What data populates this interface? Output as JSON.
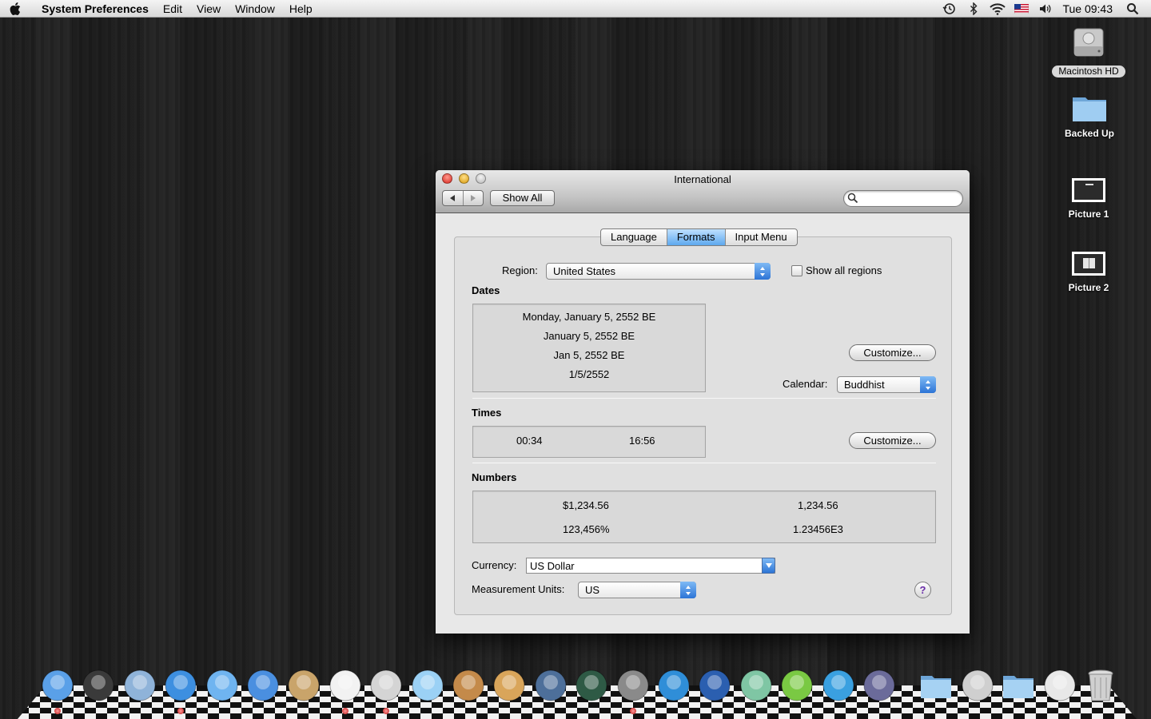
{
  "menubar": {
    "apple_label": "",
    "items": [
      "System Preferences",
      "Edit",
      "View",
      "Window",
      "Help"
    ],
    "clock": "Tue 09:43",
    "status_icons": [
      "time-machine-icon",
      "bluetooth-icon",
      "wifi-icon",
      "flag-icon",
      "volume-icon",
      "spotlight-icon"
    ]
  },
  "desktop": {
    "icons": [
      {
        "label": "Macintosh HD",
        "icon": "hard-drive-icon"
      },
      {
        "label": "Backed Up",
        "icon": "folder-icon"
      },
      {
        "label": "Picture 1",
        "icon": "image-file-icon"
      },
      {
        "label": "Picture 2",
        "icon": "image-file-icon"
      }
    ]
  },
  "window": {
    "title": "International",
    "show_all": "Show All",
    "search_placeholder": "",
    "tabs": [
      {
        "label": "Language",
        "active": false
      },
      {
        "label": "Formats",
        "active": true
      },
      {
        "label": "Input Menu",
        "active": false
      }
    ],
    "region": {
      "label": "Region:",
      "value": "United States"
    },
    "show_all_regions": {
      "label": "Show all regions",
      "checked": false
    },
    "dates": {
      "title": "Dates",
      "lines": [
        "Monday, January 5, 2552 BE",
        "January 5, 2552 BE",
        "Jan 5, 2552 BE",
        "1/5/2552"
      ],
      "customize": "Customize...",
      "calendar_label": "Calendar:",
      "calendar_value": "Buddhist"
    },
    "times": {
      "title": "Times",
      "values": [
        "00:34",
        "16:56"
      ],
      "customize": "Customize..."
    },
    "numbers": {
      "title": "Numbers",
      "values": [
        "$1,234.56",
        "1,234.56",
        "123,456%",
        "1.23456E3"
      ]
    },
    "currency": {
      "label": "Currency:",
      "value": "US Dollar"
    },
    "measurement": {
      "label": "Measurement Units:",
      "value": "US"
    },
    "help": "?"
  },
  "dock": {
    "icons": [
      "finder-icon",
      "dashboard-icon",
      "mail-icon",
      "safari-icon",
      "ichat-icon",
      "word-icon",
      "address-book-icon",
      "ical-icon",
      "preview-icon",
      "itunes-icon",
      "iphoto-icon",
      "garageband-icon",
      "spaces-icon",
      "time-machine-icon",
      "system-preferences-icon",
      "x-app-icon",
      "sync-icon",
      "hand-app-icon",
      "lime-app-icon",
      "bottle-icon",
      "automator-icon",
      "folder-icon",
      "documents-icon",
      "folder-icon",
      "mail-stack-icon",
      "trash-icon"
    ]
  }
}
